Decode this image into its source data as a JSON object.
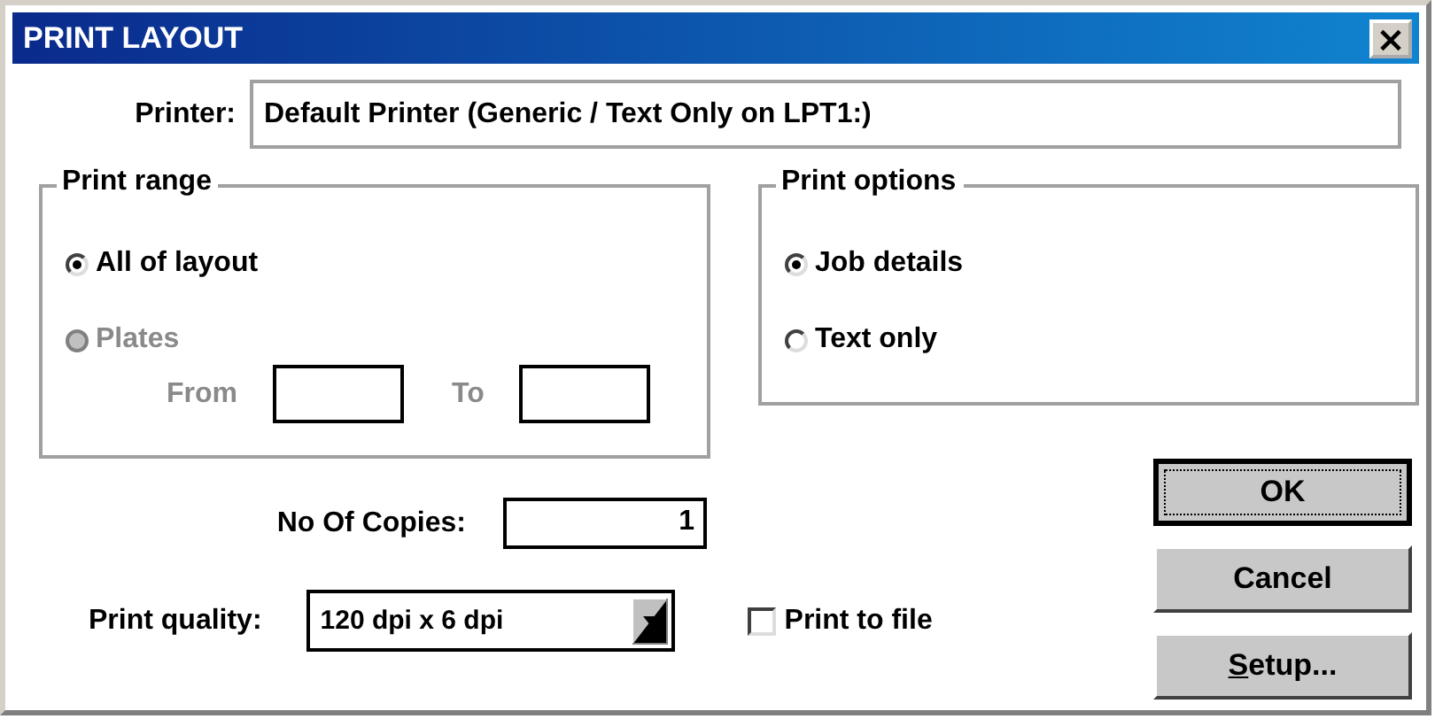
{
  "window": {
    "title": "PRINT LAYOUT",
    "close": "×"
  },
  "printer": {
    "label": "Printer:",
    "value": "Default Printer (Generic / Text Only on LPT1:)"
  },
  "print_range": {
    "title": "Print range",
    "options": [
      {
        "label": "All of layout",
        "selected": true,
        "disabled": false
      },
      {
        "label": "Plates",
        "selected": false,
        "disabled": true
      }
    ],
    "from": {
      "label": "From",
      "disabled": true
    },
    "to": {
      "label": "To",
      "disabled": true
    }
  },
  "print_options": {
    "title": "Print options",
    "options": [
      {
        "label": "Job details",
        "selected": true,
        "disabled": false
      },
      {
        "label": "Text only",
        "selected": false,
        "disabled": false
      }
    ]
  },
  "copies": {
    "label": "No Of Copies:",
    "value": "1"
  },
  "quality": {
    "label": "Print quality:",
    "value": "120 dpi x 6 dpi"
  },
  "print_to_file": {
    "label": "Print to file",
    "checked": false
  },
  "buttons": [
    {
      "label": "OK",
      "default": true,
      "mnemonic": false
    },
    {
      "label": "Cancel",
      "default": false,
      "mnemonic": false
    },
    {
      "label": "Setup...",
      "default": false,
      "mnemonic": true
    }
  ]
}
